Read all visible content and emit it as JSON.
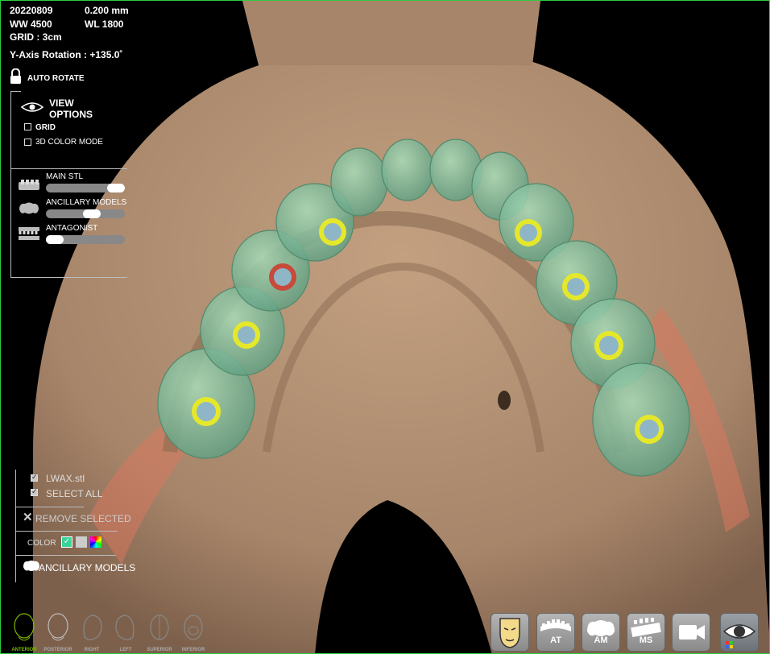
{
  "scan_info": {
    "date": "20220809",
    "ww": "WW 4500",
    "grid": "GRID : 3cm",
    "thickness": "0.200 mm",
    "wl": "WL 1800",
    "rotation": "Y-Axis Rotation : +135.0˚"
  },
  "auto_rotate": {
    "label": "AUTO ROTATE"
  },
  "view_options": {
    "title_line1": "VIEW",
    "title_line2": "OPTIONS",
    "grid_label": "GRID",
    "grid_checked": false,
    "color_mode_label": "3D COLOR MODE",
    "color_mode_checked": false
  },
  "models": [
    {
      "label": "MAIN STL",
      "opacity": 1.0
    },
    {
      "label": "ANCILLARY MODELS",
      "opacity": 0.6
    },
    {
      "label": "ANTAGONIST",
      "opacity": 0.1
    }
  ],
  "list_panel": {
    "item_label": "LWAX.stl",
    "item_checked": true,
    "select_all_label": "SELECT ALL",
    "select_all_checked": true,
    "remove_label": "REMOVE SELECTED",
    "color_label": "COLOR",
    "ancillary_button_label": "ANCILLARY MODELS"
  },
  "head_views": [
    {
      "label": "ANTERIOR",
      "active": true
    },
    {
      "label": "POSTERIOR",
      "active": false
    },
    {
      "label": "RIGHT",
      "active": false
    },
    {
      "label": "LEFT",
      "active": false
    },
    {
      "label": "SUPERIOR",
      "active": false
    },
    {
      "label": "INFERIOR",
      "active": false
    }
  ],
  "toolbar": {
    "face_icon": "face-mask-icon",
    "at_label": "AT",
    "am_label": "AM",
    "ms_label": "MS",
    "camera_icon": "video-camera-icon",
    "eye_icon": "eye-icon"
  },
  "colors": {
    "model": "#b08d6f",
    "teeth": "#88c9a0",
    "implant_yellow": "#e5e82a",
    "implant_red": "#c84a3a",
    "active_green": "#7fb800"
  }
}
